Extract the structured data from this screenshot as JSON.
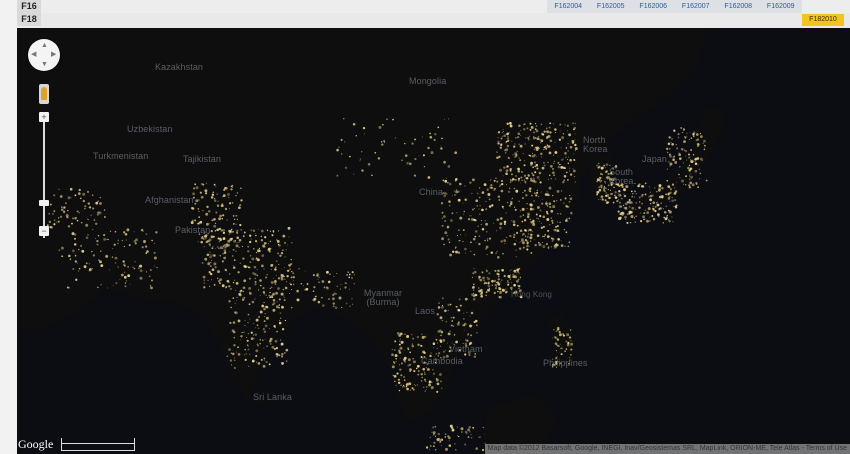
{
  "satellites": [
    "F16",
    "F18"
  ],
  "tabs": [
    "F162004",
    "F162005",
    "F162006",
    "F162007",
    "F162008",
    "F162009"
  ],
  "active_tab": "F182010",
  "places": [
    {
      "label": "Kazakhstan",
      "kind": "country"
    },
    {
      "label": "Mongolia",
      "kind": "country"
    },
    {
      "label": "Uzbekistan",
      "kind": "country"
    },
    {
      "label": "Turkmenistan",
      "kind": "country"
    },
    {
      "label": "Tajikistan",
      "kind": "country"
    },
    {
      "label": "North Korea",
      "kind": "country"
    },
    {
      "label": "South Korea",
      "kind": "country"
    },
    {
      "label": "Japan",
      "kind": "country"
    },
    {
      "label": "Afghanistan",
      "kind": "country"
    },
    {
      "label": "China",
      "kind": "country"
    },
    {
      "label": "Pakistan",
      "kind": "country"
    },
    {
      "label": "Myanmar (Burma)",
      "kind": "country"
    },
    {
      "label": "Hong Kong",
      "kind": "city"
    },
    {
      "label": "Laos",
      "kind": "country"
    },
    {
      "label": "Vietnam",
      "kind": "country"
    },
    {
      "label": "Cambodia",
      "kind": "country"
    },
    {
      "label": "Philippines",
      "kind": "country"
    },
    {
      "label": "Sri Lanka",
      "kind": "country"
    }
  ],
  "logo": "Google",
  "attribution": "Map data ©2012 Basarsoft, Google, INEGI, Inav/Geosistemas SRL, MapLink, ORION-ME, Tele Atlas - Terms of Use",
  "colors": {
    "ocean": "#0b0d12",
    "land": "#0d0d0e",
    "lights": "#f0d890",
    "active_tab": "#f2c51e"
  },
  "icons": [
    "pan-control-icon",
    "pegman-icon",
    "zoom-in-icon",
    "zoom-out-icon"
  ]
}
